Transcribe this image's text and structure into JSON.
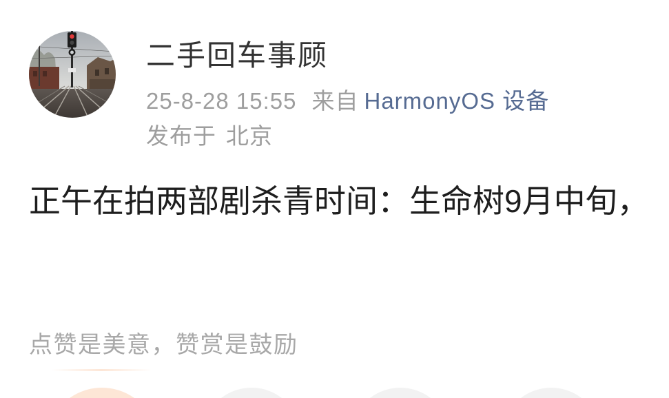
{
  "post": {
    "author": {
      "name": "二手回车事顾"
    },
    "meta": {
      "time": "25-8-28 15:55",
      "source_prefix": "来自",
      "source_name": "HarmonyOS 设备",
      "location_prefix": "发布于",
      "location": "北京"
    },
    "text": "正午在拍两部剧杀青时间：生命树9月中旬，"
  },
  "reward": {
    "prompt": "点赞是美意，赞赏是鼓励"
  },
  "colors": {
    "background": "#ffffff",
    "username": "#333333",
    "meta_gray": "#9e9e9e",
    "source_link": "#566b92",
    "body_text": "#1e1e1e",
    "prompt_gray": "#a8a8a8",
    "reward_accent": "#fde6d6",
    "action_gray": "#f2f2f2"
  }
}
